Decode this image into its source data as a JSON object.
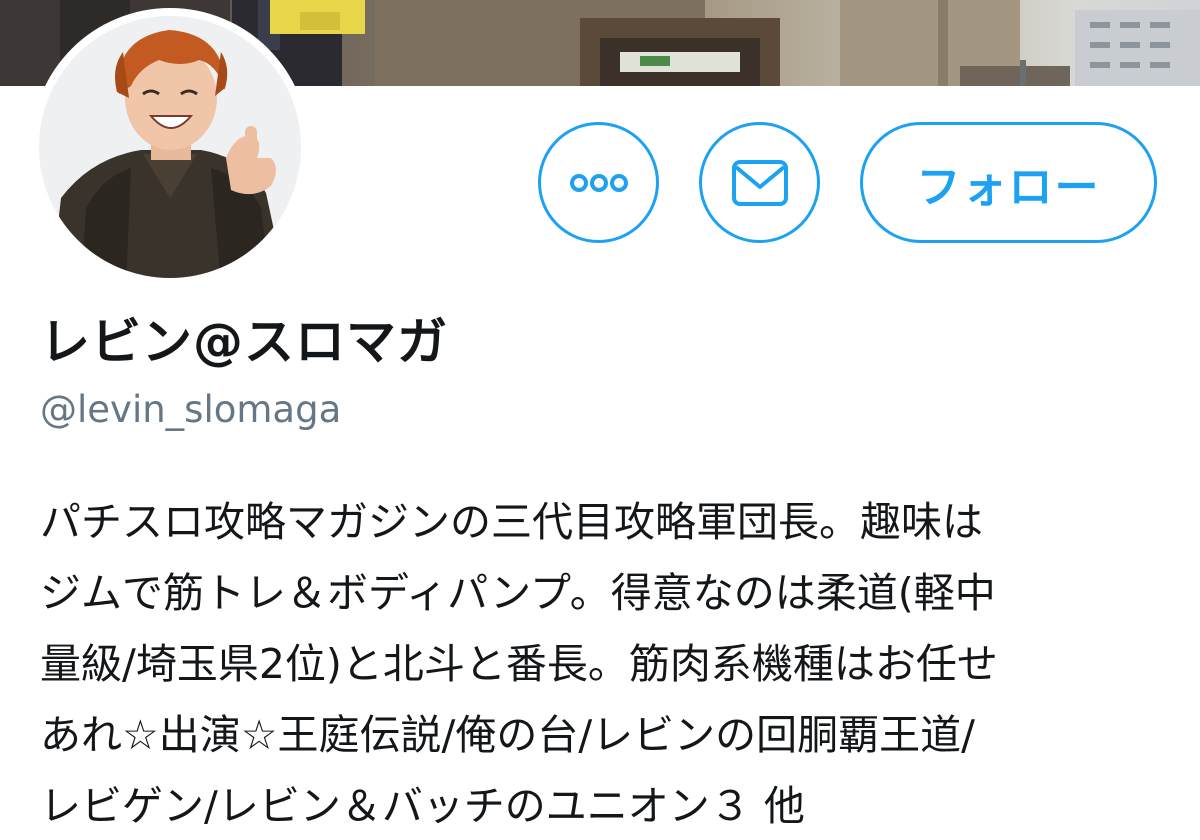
{
  "profile": {
    "display_name": "レビン@スロマガ",
    "handle": "@levin_slomaga",
    "bio_lines": [
      "パチスロ攻略マガジンの三代目攻略軍団長。趣味は",
      "ジムで筋トレ＆ボディパンプ。得意なのは柔道(軽中",
      "量級/埼玉県2位)と北斗と番長。筋肉系機種はお任せ",
      "あれ☆出演☆王庭伝説/俺の台/レビンの回胴覇王道/",
      "レビゲン/レビン＆バッチのユニオン３ 他"
    ]
  },
  "actions": {
    "more_icon": "more-icon",
    "message_icon": "envelope-icon",
    "follow_label": "フォロー"
  },
  "colors": {
    "accent": "#1da1f2",
    "text": "#14171a",
    "secondary_text": "#657786",
    "background": "#ffffff"
  }
}
